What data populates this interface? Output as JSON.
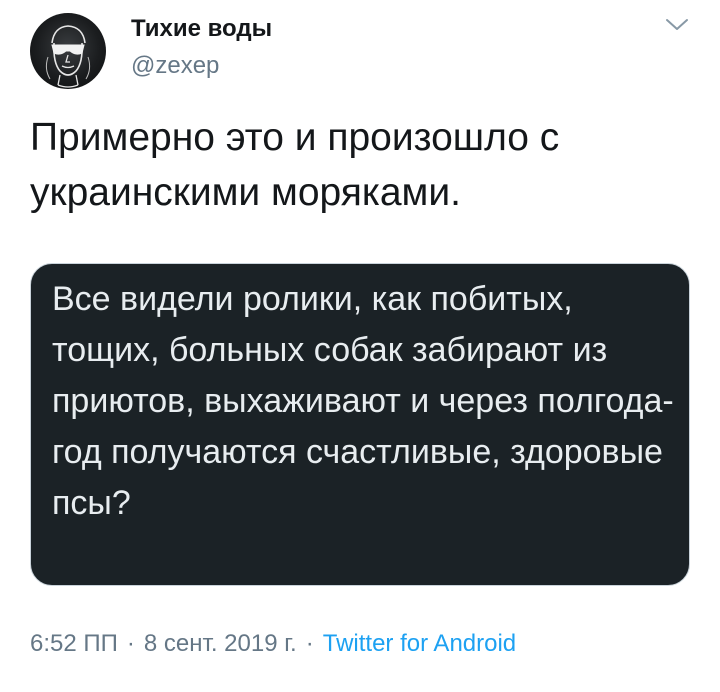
{
  "author": {
    "name": "Тихие воды",
    "handle": "@zexep"
  },
  "tweet": {
    "text": "Примерно это и произошло с украинскими моряками."
  },
  "media": {
    "text": "Все видели ролики, как побитых, тощих, больных собак забирают из приютов, выхаживают и через полгода-год получаются счастливые, здоровые псы?",
    "background": "#1b2226"
  },
  "meta": {
    "time": "6:52 ПП",
    "date": "8 сент. 2019 г.",
    "separator": "·",
    "source": "Twitter for Android"
  },
  "icons": {
    "avatar": "masked-face-avatar",
    "menu": "chevron-down-icon"
  },
  "colors": {
    "accent": "#1da1f2",
    "secondary_text": "#657786",
    "primary_text": "#14171a"
  }
}
